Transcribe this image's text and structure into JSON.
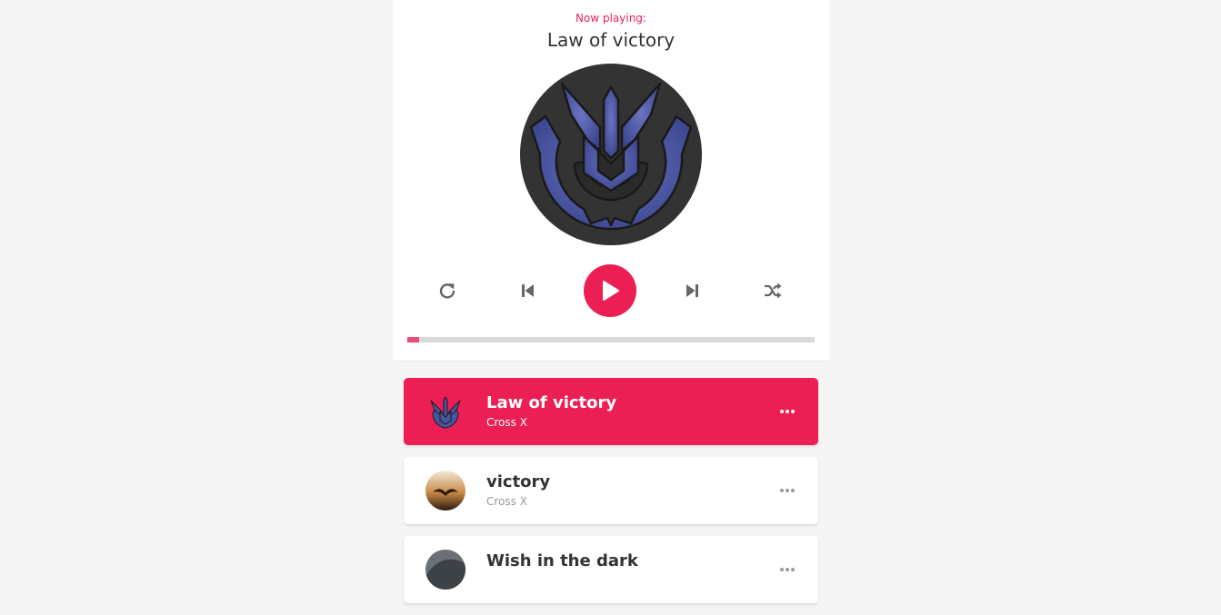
{
  "header": {
    "now_playing_label": "Now playing:",
    "current_song_title": "Law of victory"
  },
  "progress": {
    "percent": 3
  },
  "colors": {
    "accent": "#ec1f55",
    "cd_bg": "#333333",
    "emblem": "#4a55a0"
  },
  "controls": {
    "repeat_icon": "repeat-icon",
    "prev_icon": "step-backward-icon",
    "play_icon": "play-icon",
    "next_icon": "step-forward-icon",
    "shuffle_icon": "shuffle-icon"
  },
  "playlist": [
    {
      "title": "Law of victory",
      "author": "Cross X",
      "active": true,
      "thumb": "emblem"
    },
    {
      "title": "victory",
      "author": "Cross X",
      "active": false,
      "thumb": "sunset-bird"
    },
    {
      "title": "Wish in the dark",
      "author": "",
      "active": false,
      "thumb": "gray"
    }
  ]
}
